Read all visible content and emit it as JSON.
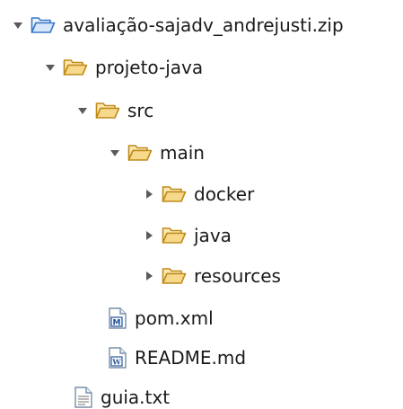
{
  "tree": {
    "root": {
      "label": "avaliação-sajadv_andrejusti.zip",
      "icon": "folder-open-blue-icon",
      "expanded": true
    },
    "projeto": {
      "label": "projeto-java",
      "icon": "folder-open-icon",
      "expanded": true
    },
    "src": {
      "label": "src",
      "icon": "folder-open-icon",
      "expanded": true
    },
    "main": {
      "label": "main",
      "icon": "folder-open-icon",
      "expanded": true
    },
    "docker": {
      "label": "docker",
      "icon": "folder-icon",
      "expanded": false
    },
    "java": {
      "label": "java",
      "icon": "folder-icon",
      "expanded": false
    },
    "resources": {
      "label": "resources",
      "icon": "folder-icon",
      "expanded": false
    },
    "pom": {
      "label": "pom.xml",
      "icon": "maven-file-icon",
      "glyph": "M"
    },
    "readme": {
      "label": "README.md",
      "icon": "word-file-icon",
      "glyph": "W"
    },
    "guia": {
      "label": "guia.txt",
      "icon": "text-file-icon"
    }
  },
  "colors": {
    "folder_fill": "#f7d98c",
    "folder_stroke": "#c08b1a",
    "root_folder_fill": "#d7e8fb",
    "root_folder_stroke": "#3a78c7",
    "twisty": "#5a5a5a",
    "doc_stroke": "#7a8ea8",
    "maven_blue": "#1c4e9a",
    "word_blue": "#2b579a"
  }
}
